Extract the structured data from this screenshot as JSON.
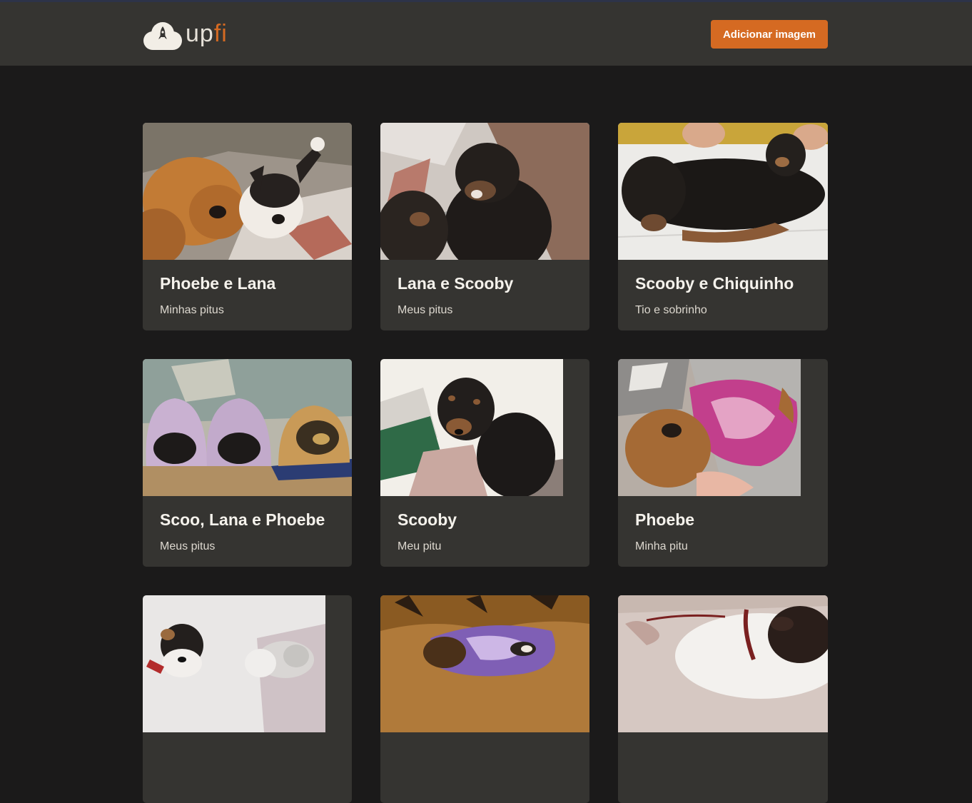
{
  "app": {
    "logo_text": "up",
    "logo_accent": "fi",
    "add_button_label": "Adicionar imagem",
    "accent_color": "#d56a22"
  },
  "cards": [
    {
      "title": "Phoebe e Lana",
      "description": "Minhas pitus"
    },
    {
      "title": "Lana e Scooby",
      "description": "Meus pitus"
    },
    {
      "title": "Scooby e Chiquinho",
      "description": "Tio e sobrinho"
    },
    {
      "title": "Scoo, Lana e Phoebe",
      "description": "Meus pitus"
    },
    {
      "title": "Scooby",
      "description": "Meu pitu"
    },
    {
      "title": "Phoebe",
      "description": "Minha pitu"
    },
    {
      "title": "",
      "description": ""
    },
    {
      "title": "",
      "description": ""
    },
    {
      "title": "",
      "description": ""
    }
  ]
}
